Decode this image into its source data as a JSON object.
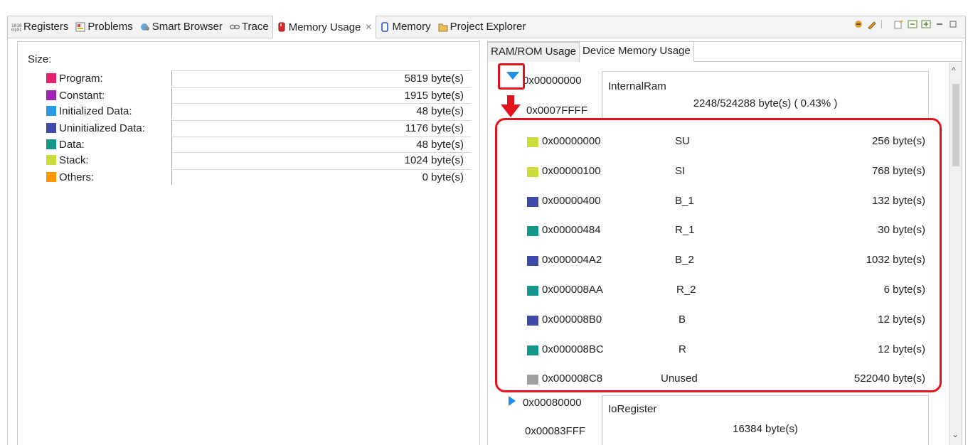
{
  "tabs": [
    {
      "label": "Registers",
      "icon": "registers-icon",
      "active": false
    },
    {
      "label": "Problems",
      "icon": "problems-icon",
      "active": false
    },
    {
      "label": "Smart Browser",
      "icon": "smart-browser-icon",
      "active": false
    },
    {
      "label": "Trace",
      "icon": "trace-icon",
      "active": false
    },
    {
      "label": "Memory Usage",
      "icon": "memory-usage-icon",
      "active": true
    },
    {
      "label": "Memory",
      "icon": "memory-icon",
      "active": false
    },
    {
      "label": "Project Explorer",
      "icon": "project-explorer-icon",
      "active": false
    }
  ],
  "size_panel": {
    "title": "Size:",
    "rows": [
      {
        "name": "Program:",
        "value": "5819",
        "unit": "byte(s)",
        "color": "#e5226b"
      },
      {
        "name": "Constant:",
        "value": "1915",
        "unit": "byte(s)",
        "color": "#a020b4"
      },
      {
        "name": "Initialized Data:",
        "value": "48",
        "unit": "byte(s)",
        "color": "#2b9be8"
      },
      {
        "name": "Uninitialized Data:",
        "value": "1176",
        "unit": "byte(s)",
        "color": "#3d4aa8"
      },
      {
        "name": "Data:",
        "value": "48",
        "unit": "byte(s)",
        "color": "#14968a"
      },
      {
        "name": "Stack:",
        "value": "1024",
        "unit": "byte(s)",
        "color": "#cbdc3c"
      },
      {
        "name": "Others:",
        "value": "0",
        "unit": "byte(s)",
        "color": "#ff9800"
      }
    ]
  },
  "right_panel": {
    "tabs": [
      {
        "label": "RAM/ROM Usage",
        "selected": false
      },
      {
        "label": "Device Memory Usage",
        "selected": true
      }
    ],
    "regions": [
      {
        "start": "0x00000000",
        "end": "0x0007FFFF",
        "name": "InternalRam",
        "usage": "2248/524288 byte(s) ( 0.43% )",
        "expanded": true
      },
      {
        "start": "0x00080000",
        "end": "0x00083FFF",
        "name": "IoRegister",
        "usage": "16384 byte(s)",
        "expanded": false
      }
    ],
    "sections": [
      {
        "addr": "0x00000000",
        "name": "SU",
        "size": "256 byte(s)",
        "color": "#cbdc3c"
      },
      {
        "addr": "0x00000100",
        "name": "SI",
        "size": "768 byte(s)",
        "color": "#cbdc3c"
      },
      {
        "addr": "0x00000400",
        "name": "B_1",
        "size": "132 byte(s)",
        "color": "#3d4aa8"
      },
      {
        "addr": "0x00000484",
        "name": "R_1",
        "size": "30 byte(s)",
        "color": "#14968a"
      },
      {
        "addr": "0x000004A2",
        "name": "B_2",
        "size": "1032 byte(s)",
        "color": "#3d4aa8"
      },
      {
        "addr": "0x000008AA",
        "name": "R_2",
        "size": "6 byte(s)",
        "color": "#14968a"
      },
      {
        "addr": "0x000008B0",
        "name": "B",
        "size": "12 byte(s)",
        "color": "#3d4aa8"
      },
      {
        "addr": "0x000008BC",
        "name": "R",
        "size": "12 byte(s)",
        "color": "#14968a"
      },
      {
        "addr": "0x000008C8",
        "name": "Unused",
        "size": "522040 byte(s)",
        "color": "#a0a0a0"
      }
    ]
  },
  "colors": {
    "annotation_red": "#e2131a",
    "expand_arrow": "#1e90e8"
  }
}
